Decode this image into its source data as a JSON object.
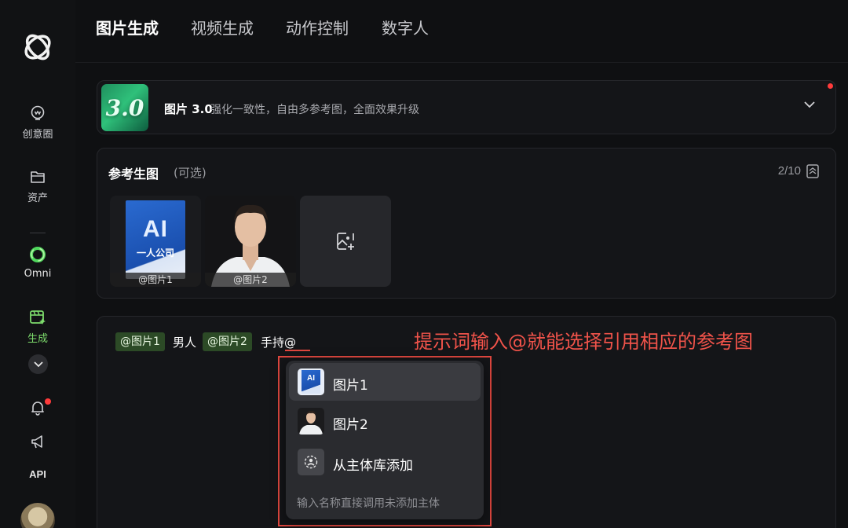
{
  "nav": {
    "tabs": [
      "图片生成",
      "视频生成",
      "动作控制",
      "数字人"
    ],
    "active_tab": "图片生成"
  },
  "sidebar": {
    "items": [
      {
        "label": "创意圈",
        "icon": "idea-bulb-icon"
      },
      {
        "label": "资产",
        "icon": "folder-icon"
      },
      {
        "label": "Omni",
        "icon": "omni-ring-icon"
      },
      {
        "label": "生成",
        "icon": "generate-icon"
      }
    ],
    "api_label": "API",
    "accent": "#7ddc6c"
  },
  "model": {
    "badge": "3.0",
    "name": "图片 3.0",
    "description": "强化一致性，自由多参考图，全面效果升级"
  },
  "reference": {
    "title": "参考生图",
    "optional": "(可选)",
    "count": "2/10",
    "images": [
      {
        "label": "@图片1",
        "book_title": "AI",
        "book_subtitle": "一人公司"
      },
      {
        "label": "@图片2"
      }
    ]
  },
  "prompt": {
    "chip1": "@图片1",
    "text1": "男人",
    "chip2": "@图片2",
    "text2": "手持@",
    "annotation": "提示词输入@就能选择引用相应的参考图"
  },
  "dropdown": {
    "items": [
      {
        "label": "图片1",
        "thumb_text": "AI"
      },
      {
        "label": "图片2"
      },
      {
        "label": "从主体库添加"
      }
    ],
    "hint": "输入名称直接调用未添加主体"
  },
  "colors": {
    "highlight_red": "#e0473f",
    "chip_green": "#2c4a26"
  }
}
